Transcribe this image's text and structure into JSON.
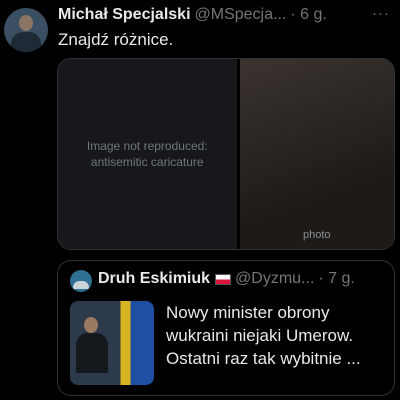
{
  "tweet": {
    "author_name": "Michał Specjalski",
    "author_handle": "@MSpecja...",
    "time": "· 6 g.",
    "more": "···",
    "text": "Znajdź różnice.",
    "media": {
      "left_notice": "Image not reproduced: antisemitic caricature",
      "right_label": "photo"
    }
  },
  "quote": {
    "author_name": "Druh Eskimiuk",
    "author_handle": "@Dyzmu...",
    "time": "· 7 g.",
    "text_lines": [
      "Nowy minister obrony",
      "wukraini niejaki Umerow.",
      "Ostatni raz tak wybitnie ..."
    ]
  }
}
